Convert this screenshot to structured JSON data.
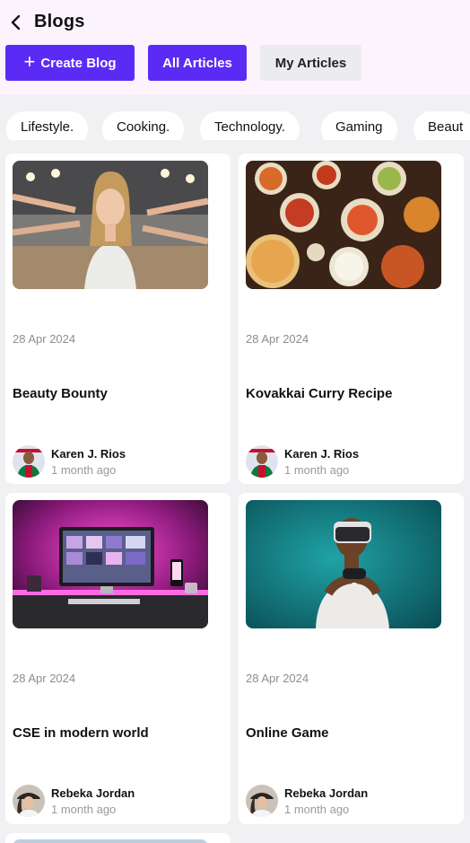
{
  "header": {
    "title": "Blogs"
  },
  "actions": {
    "create_label": "Create Blog",
    "all_label": "All Articles",
    "my_label": "My Articles"
  },
  "categories": [
    "Lifestyle.",
    "Cooking.",
    "Technology.",
    "Gaming",
    "Beaut"
  ],
  "cards": [
    {
      "date": "28 Apr 2024",
      "title": "Beauty Bounty",
      "author": "Karen J. Rios",
      "ago": "1 month ago",
      "image": "woman-makeup-photo",
      "avatar": "footballer-avatar"
    },
    {
      "date": "28 Apr 2024",
      "title": "Kovakkai Curry Recipe",
      "author": "Karen J. Rios",
      "ago": "1 month ago",
      "image": "indian-food-photo",
      "avatar": "footballer-avatar"
    },
    {
      "date": "28 Apr 2024",
      "title": "CSE in modern world",
      "author": "Rebeka Jordan",
      "ago": "1 month ago",
      "image": "pink-desk-setup-photo",
      "avatar": "woman-hat-avatar"
    },
    {
      "date": "28 Apr 2024",
      "title": "Online Game",
      "author": "Rebeka Jordan",
      "ago": "1 month ago",
      "image": "vr-gamer-photo",
      "avatar": "woman-hat-avatar"
    }
  ],
  "colors": {
    "accent": "#5b2bf5",
    "header_bg": "#fbf4fd",
    "page_bg": "#f1f1f3"
  }
}
